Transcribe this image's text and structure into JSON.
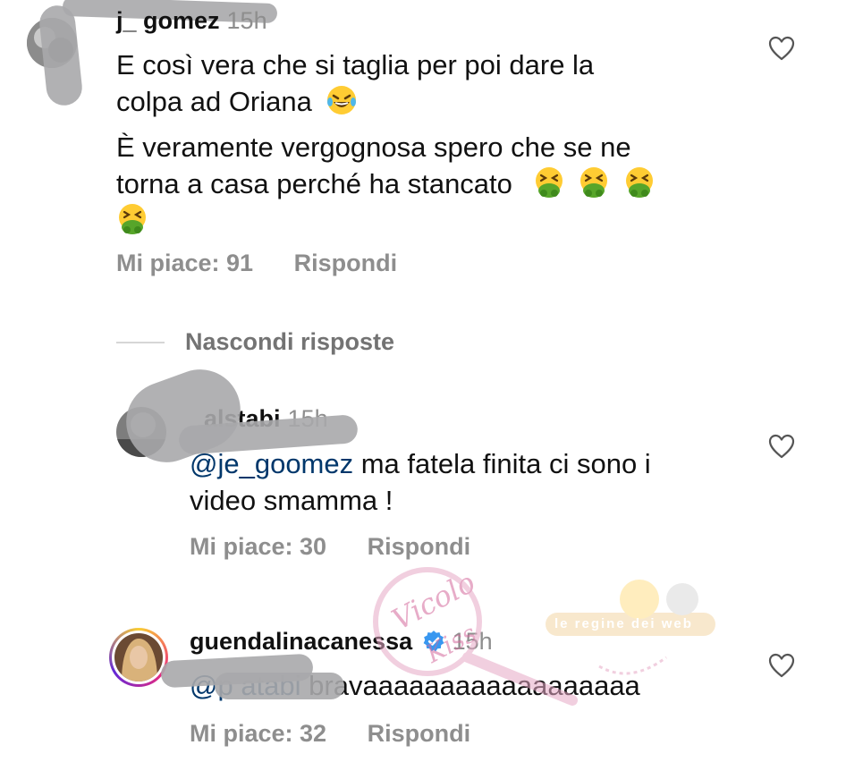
{
  "comment1": {
    "username": "j_ gomez",
    "time": "15h",
    "paragraph1_line1": "E così vera che si taglia per poi dare la",
    "paragraph1_line2": "colpa ad Oriana",
    "paragraph2_line1": "È veramente vergognosa spero che se ne",
    "paragraph2_line2": "torna a casa perché ha stancato",
    "likes": "Mi piace: 91",
    "reply": "Rispondi",
    "emoji_laugh": "face-with-tears-of-joy",
    "emoji_vomit": "face-vomiting"
  },
  "hide_replies": "Nascondi risposte",
  "reply1": {
    "username": "alstabi",
    "time": "15h",
    "mention": "@je_goomez",
    "text_line1": " ma fatela finita ci sono i",
    "text_line2": "video smamma !",
    "likes": "Mi piace: 30",
    "reply": "Rispondi"
  },
  "reply2": {
    "username": "guendalinacanessa",
    "time": "15h",
    "mention": "@p     atabi",
    "text": " bravaaaaaaaaaaaaaaaaaa",
    "likes": "Mi piace: 32",
    "reply": "Rispondi",
    "verified_icon": "verified-badge-icon"
  },
  "watermark": {
    "text1": "Vicolo",
    "text2": "Kiss",
    "banner": "le regine dei web"
  },
  "colors": {
    "meta_gray": "#8e8e8e",
    "mention_blue": "#00376b",
    "verified_blue": "#3897f0",
    "watermark_pink": "#e7a9c6"
  }
}
